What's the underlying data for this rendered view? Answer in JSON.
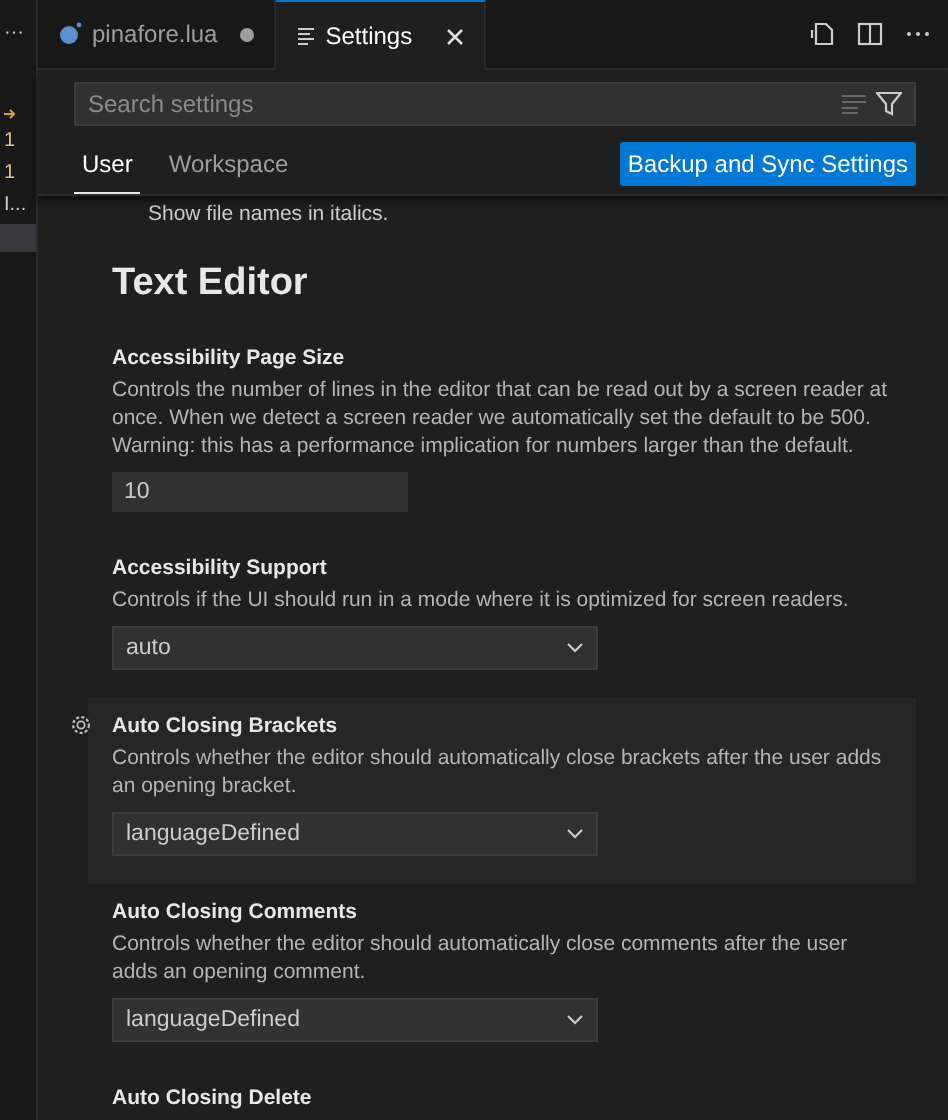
{
  "side_strip": {
    "items": [
      {
        "kind": "more",
        "text": "···"
      },
      {
        "kind": "arrow"
      },
      {
        "kind": "count",
        "text": "1"
      },
      {
        "kind": "count",
        "text": "1"
      },
      {
        "kind": "label",
        "text": "I..."
      },
      {
        "kind": "highlight"
      }
    ]
  },
  "tabs": [
    {
      "label": "pinafore.lua",
      "kind": "file",
      "selected": false,
      "modified": true
    },
    {
      "label": "Settings",
      "kind": "settings",
      "selected": true,
      "modified": false
    }
  ],
  "search": {
    "placeholder": "Search settings"
  },
  "scopes": [
    {
      "label": "User",
      "selected": true
    },
    {
      "label": "Workspace",
      "selected": false
    }
  ],
  "sync_button": "Backup and Sync Settings",
  "cut_text": "Show file names in italics.",
  "section_title": "Text Editor",
  "settings": [
    {
      "title": "Accessibility Page Size",
      "description": "Controls the number of lines in the editor that can be read out by a screen reader at once. When we detect a screen reader we automatically set the default to be 500. Warning: this has a performance implication for numbers larger than the default.",
      "kind": "number",
      "value": "10",
      "focused": false
    },
    {
      "title": "Accessibility Support",
      "description": "Controls if the UI should run in a mode where it is optimized for screen readers.",
      "kind": "dropdown",
      "value": "auto",
      "focused": false
    },
    {
      "title": "Auto Closing Brackets",
      "description": "Controls whether the editor should automatically close brackets after the user adds an opening bracket.",
      "kind": "dropdown",
      "value": "languageDefined",
      "focused": true
    },
    {
      "title": "Auto Closing Comments",
      "description": "Controls whether the editor should automatically close comments after the user adds an opening comment.",
      "kind": "dropdown",
      "value": "languageDefined",
      "focused": false
    },
    {
      "title": "Auto Closing Delete",
      "kind": "title_only",
      "focused": false
    }
  ]
}
